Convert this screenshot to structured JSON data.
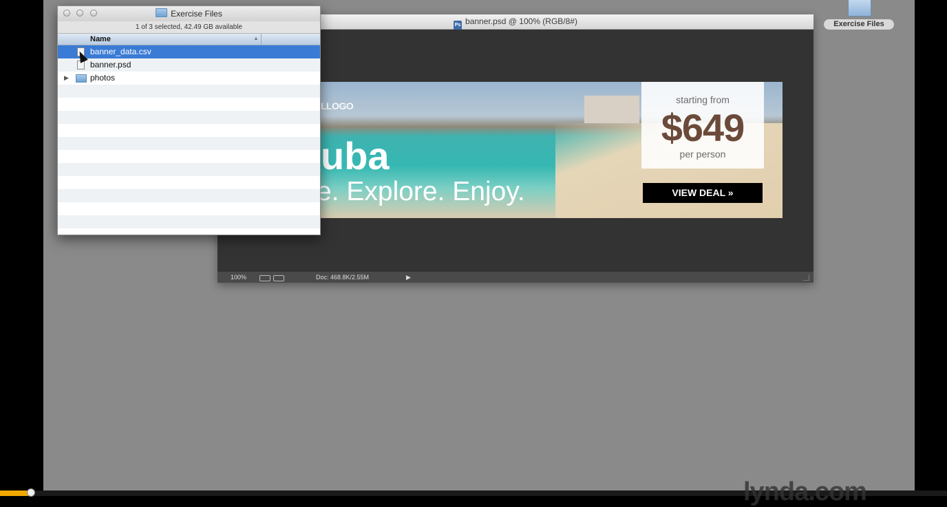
{
  "photoshop": {
    "title": "banner.psd @ 100% (RGB/8#)",
    "icon": "psd-file-icon",
    "status": {
      "zoom": "100%",
      "doc_size": "Doc: 468.8K/2.55M"
    }
  },
  "banner": {
    "logo": "LLOGO",
    "destination": "uba",
    "tagline": "e. Explore. Enjoy.",
    "starting_from": "starting from",
    "price": "$649",
    "per_person": "per person",
    "cta": "VIEW DEAL »"
  },
  "finder": {
    "title": "Exercise Files",
    "info": "1 of 3 selected, 42.49 GB available",
    "column_header": "Name",
    "items": [
      {
        "label": "banner_data.csv",
        "type": "file",
        "selected": true
      },
      {
        "label": "banner.psd",
        "type": "file",
        "selected": false
      },
      {
        "label": "photos",
        "type": "folder",
        "selected": false
      }
    ]
  },
  "desktop": {
    "icon_label": "Exercise Files"
  },
  "video": {
    "watermark": "lynda.com",
    "progress_color": "#f2a900"
  }
}
